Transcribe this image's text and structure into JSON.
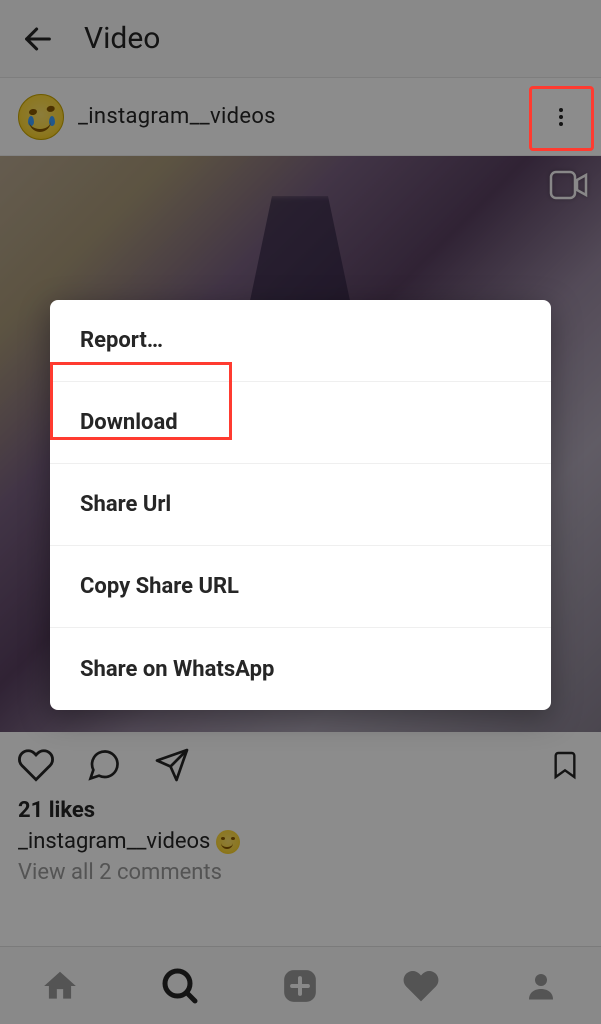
{
  "header": {
    "title": "Video"
  },
  "post": {
    "username": "_instagram__videos",
    "likes_text": "21 likes",
    "caption_username": "_instagram__videos",
    "view_all": "View all 2 comments"
  },
  "menu": {
    "items": [
      "Report…",
      "Download",
      "Share Url",
      "Copy Share URL",
      "Share on WhatsApp"
    ]
  }
}
